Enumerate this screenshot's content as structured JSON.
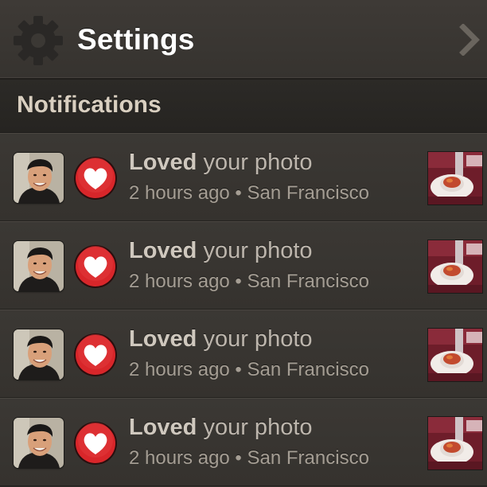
{
  "header": {
    "title": "Settings",
    "icon": "gear-icon",
    "disclosure_icon": "chevron-right-icon"
  },
  "section": {
    "title": "Notifications"
  },
  "notifications": [
    {
      "verb": "Loved",
      "rest": " your photo",
      "time": "2 hours ago",
      "separator": " • ",
      "location": "San Francisco"
    },
    {
      "verb": "Loved",
      "rest": " your photo",
      "time": "2 hours ago",
      "separator": " • ",
      "location": "San Francisco"
    },
    {
      "verb": "Loved",
      "rest": " your photo",
      "time": "2 hours ago",
      "separator": " • ",
      "location": "San Francisco"
    },
    {
      "verb": "Loved",
      "rest": " your photo",
      "time": "2 hours ago",
      "separator": " • ",
      "location": "San Francisco"
    }
  ],
  "colors": {
    "heart_red": "#d8262a",
    "section_text": "#d9cfc0",
    "title_text": "#ffffff"
  }
}
